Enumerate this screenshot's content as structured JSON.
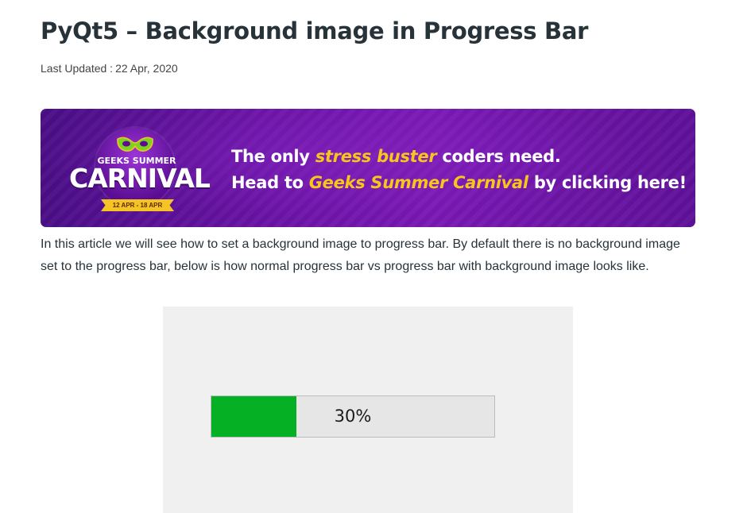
{
  "article": {
    "title": "PyQt5 – Background image in Progress Bar",
    "updated_label": "Last Updated :",
    "updated_date": "22 Apr, 2020",
    "intro": "In this article we will see how to set a background image to progress bar. By default there is no background image set to the progress bar, below is how normal progress bar vs progress bar with background image looks like."
  },
  "banner": {
    "badge_top": "GEEKS SUMMER",
    "badge_main": "CARNIVAL",
    "badge_dates": "12 APR - 18 APR",
    "line1_pre": "The only ",
    "line1_hl": "stress buster",
    "line1_post": " coders need.",
    "line2_pre": "Head to ",
    "line2_hl": "Geeks Summer Carnival",
    "line2_post": " by clicking here!",
    "highlight_color": "#f8c51d",
    "background_color": "#6a13a6"
  },
  "demo": {
    "progress_value": 30,
    "progress_text": "30%",
    "chunk_color": "#06b025"
  }
}
